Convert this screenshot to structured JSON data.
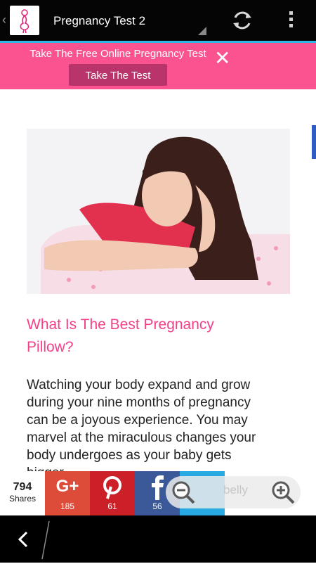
{
  "action_bar": {
    "title": "Pregnancy Test 2",
    "icons": [
      "back-caret-icon",
      "app-logo-icon",
      "refresh-icon",
      "overflow-menu-icon"
    ]
  },
  "promo": {
    "text": "Take The Free Online Pregnancy Test",
    "button_label": "Take The Test",
    "close_glyph": "✕"
  },
  "article": {
    "title": "What Is The Best Pregnancy Pillow?",
    "body": "Watching your body expand and grow during your nine months of pregnancy can be a joyous experience. You may marvel at the miraculous changes your body undergoes as your baby gets bigger."
  },
  "share": {
    "total": "794",
    "total_label": "Shares",
    "buttons": [
      {
        "network": "Google+",
        "glyph": "G+",
        "count": "185"
      },
      {
        "network": "Pinterest",
        "count": "61"
      },
      {
        "network": "Facebook",
        "count": "56"
      },
      {
        "network": "Twitter",
        "count": ""
      }
    ]
  },
  "zoom": {
    "ghost_text": "belly"
  },
  "colors": {
    "action_bar": "#050505",
    "accent_line": "#33b5e5",
    "promo_bg": "#fa5390",
    "promo_button": "#b8346b",
    "title_pink": "#f2418a",
    "gplus": "#dd4b39",
    "pinterest": "#cb2027",
    "facebook": "#3b5998",
    "twitter": "#29a9e1"
  }
}
